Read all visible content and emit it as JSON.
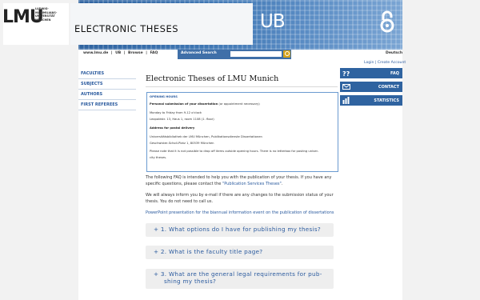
{
  "header": {
    "logo_text": "LMU",
    "logo_subtext": [
      "LUDWIG-",
      "MAXIMILIANS-",
      "UNIVERSITÄT",
      "MÜNCHEN"
    ],
    "site_title": "ELECTRONIC THESES",
    "ub_logo": "UB",
    "oa_icon": "open-access-icon"
  },
  "navbar": {
    "links": [
      "www.lmu.de",
      "|",
      "UB",
      "|",
      "Browse",
      "|",
      "FAQ"
    ],
    "advanced_search": "Advanced Search",
    "search_placeholder": "",
    "language": "Deutsch",
    "login": "Login",
    "sep": "|",
    "create_account": "Create Account"
  },
  "leftmenu": [
    "FACULTIES",
    "SUBJECTS",
    "AUTHORS",
    "FIRST REFEREES"
  ],
  "rightpanels": [
    {
      "label": "FAQ",
      "icon": "question-icon"
    },
    {
      "label": "CONTACT",
      "icon": "mail-icon"
    },
    {
      "label": "STATISTICS",
      "icon": "bar-chart-icon"
    }
  ],
  "main": {
    "title": "Electronic Theses of LMU Munich",
    "info": {
      "opening_hours": "OPENING HOURS",
      "personal_label": "Personal submission of your dissertation",
      "personal_suffix": " (or appointment necessary)",
      "days": "Monday to Friday from 9-12 o'clock",
      "room": "Leopoldstr. 13, Haus 1, room 1108 (1. floor)",
      "postal_label": "Address for postal delivery",
      "postal_line1": "Universitätsbibliothek der LMU München, Publikationsdienste Dissertationen",
      "postal_line2": "Geschwister-Scholl-Platz 1, 80539 München",
      "note_line1": "Please note that it is not possible to drop off items outside opening hours. There is no letterbox for posting univer-",
      "note_line2": "city theses."
    },
    "para1_a": "The following FAQ is intended to help you with the publication of your thesis. If you have any",
    "para1_b": "specific questions, please contact the ",
    "para1_link": "\"Publication Services Theses\"",
    "para1_c": ".",
    "para2_a": "We will always inform you by e-mail if there are any changes to the submission status of your",
    "para2_b": "thesis. You do not need to call us.",
    "ppt_link": "PowerPoint presentation for the biannual information event on the publication of dissertations",
    "faq": [
      "+  1. What options do I have for publishing my thesis?",
      "+  2. What is the faculty title page?",
      "+  3. What are the general legal requirements for pub-",
      "shing my thesis?"
    ]
  }
}
